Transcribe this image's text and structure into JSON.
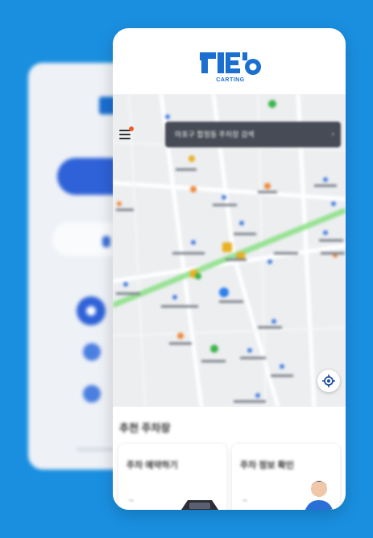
{
  "colors": {
    "background": "#1a8fe0",
    "brand": "#1a6fd0",
    "route": "#7ed87a",
    "search_bar": "#474b55"
  },
  "logo": {
    "text": "CARTING"
  },
  "map": {
    "search_text": "마포구 합정동 주차장 검색",
    "menu_icon": "hamburger-icon",
    "locate_icon": "crosshair-icon"
  },
  "recommend": {
    "title": "추천 주차장"
  },
  "cards": [
    {
      "title": "주차 예약하기",
      "arrow": "→",
      "image": "car-icon"
    },
    {
      "title": "주차 정보 확인",
      "arrow": "→",
      "image": "person-icon"
    }
  ]
}
